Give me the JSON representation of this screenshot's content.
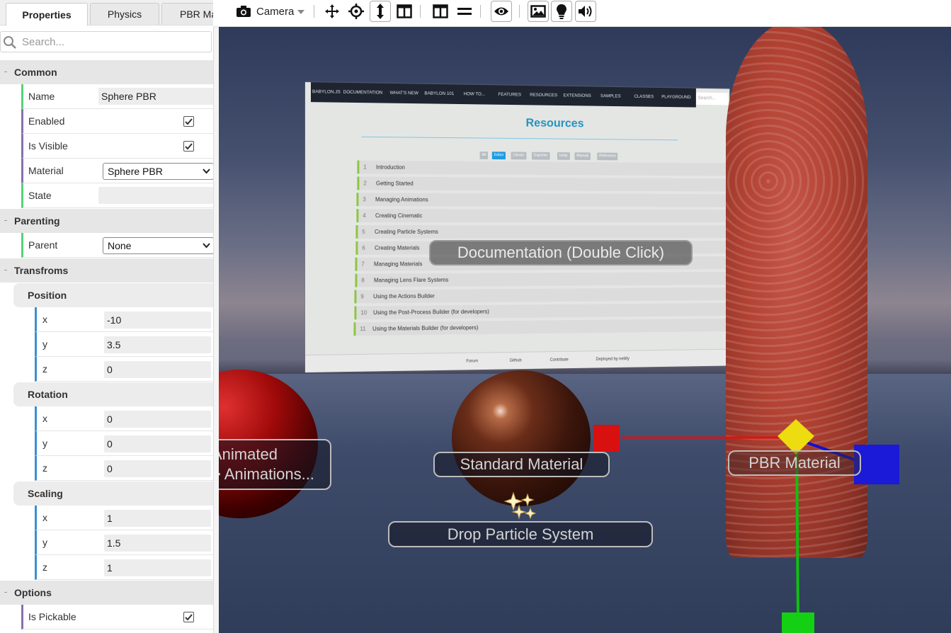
{
  "inspector": {
    "tabs": [
      "Properties",
      "Physics",
      "PBR Ma"
    ],
    "search_placeholder": "Search...",
    "sections": {
      "common": "Common",
      "parenting": "Parenting",
      "transforms": "Transfroms",
      "options": "Options"
    },
    "common": {
      "name_label": "Name",
      "name_value": "Sphere PBR",
      "enabled_label": "Enabled",
      "enabled": true,
      "visible_label": "Is Visible",
      "visible": true,
      "material_label": "Material",
      "material_value": "Sphere PBR",
      "state_label": "State",
      "state_value": ""
    },
    "parenting": {
      "parent_label": "Parent",
      "parent_value": "None"
    },
    "transforms": {
      "position": {
        "label": "Position",
        "x": "-10",
        "y": "3.5",
        "z": "0"
      },
      "rotation": {
        "label": "Rotation",
        "x": "0",
        "y": "0",
        "z": "0"
      },
      "scaling": {
        "label": "Scaling",
        "x": "1",
        "y": "1.5",
        "z": "1"
      },
      "axis": {
        "x": "x",
        "y": "y",
        "z": "z"
      }
    },
    "options": {
      "pickable_label": "Is Pickable",
      "pickable": true
    }
  },
  "toolbar": {
    "camera_label": "Camera",
    "icons": [
      "camera-icon",
      "move-icon",
      "target-icon",
      "vertical-arrow-icon",
      "split-view-icon",
      "columns-icon",
      "equals-icon",
      "eye-icon",
      "image-icon",
      "lightbulb-icon",
      "speaker-icon"
    ]
  },
  "scene": {
    "doc_screen": {
      "nav": [
        "BABYLON.JS",
        "DOCUMENTATION",
        "WHAT'S NEW",
        "BABYLON 101",
        "HOW TO...",
        "FEATURES",
        "RESOURCES",
        "EXTENSIONS",
        "SAMPLES",
        "CLASSES",
        "PLAYGROUND"
      ],
      "search": "Search...",
      "title": "Resources",
      "chips": [
        "All",
        "Editor",
        "Library",
        "Exporter",
        "Unity",
        "Manual",
        "Reference"
      ],
      "lines": [
        {
          "n": "1",
          "t": "Introduction"
        },
        {
          "n": "2",
          "t": "Getting Started"
        },
        {
          "n": "3",
          "t": "Managing Animations"
        },
        {
          "n": "4",
          "t": "Creating Cinematic"
        },
        {
          "n": "5",
          "t": "Creating Particle Systems"
        },
        {
          "n": "6",
          "t": "Creating Materials"
        },
        {
          "n": "7",
          "t": "Managing Materials"
        },
        {
          "n": "8",
          "t": "Managing Lens Flare Systems"
        },
        {
          "n": "9",
          "t": "Using the Actions Builder"
        },
        {
          "n": "10",
          "t": "Using the Post-Process Builder (for developers)"
        },
        {
          "n": "11",
          "t": "Using the Materials Builder (for developers)"
        }
      ],
      "footer": [
        "Forum",
        "Github",
        "Contribute",
        "Deployed by netlify"
      ]
    },
    "labels": {
      "documentation": "Documentation (Double Click)",
      "animated_1": "Animated",
      "animated_2": "> Animations...",
      "standard": "Standard Material",
      "pbr": "PBR Material",
      "particles": "Drop Particle System"
    }
  }
}
